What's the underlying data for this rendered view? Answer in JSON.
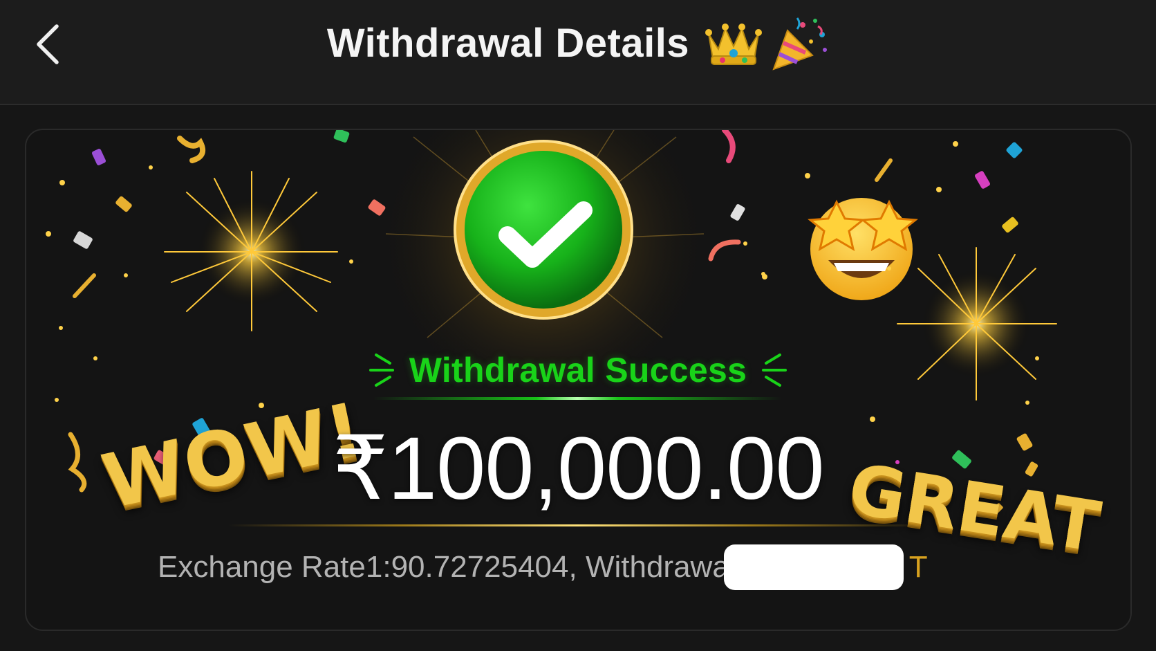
{
  "header": {
    "back_icon": "chevron-left-icon",
    "title": "Withdrawal Details",
    "title_icons": [
      "crown-icon",
      "party-popper-icon"
    ]
  },
  "card": {
    "status_icon": "green-checkmark-icon",
    "status_text": "Withdrawal Success",
    "amount": "₹100,000.00",
    "rate_text": "Exchange Rate1:90.72725404, Withdrawa",
    "rate_unit_suffix": "T",
    "decor_left_text": "WOW!",
    "decor_right_text": "GREAT",
    "decor_emoji": "star-struck-emoji-icon"
  },
  "colors": {
    "background": "#161616",
    "header_bg": "#1c1c1c",
    "success_green": "#19d319",
    "gold": "#f2c64a",
    "amount_white": "#ffffff",
    "rate_gray": "#b3b3b3"
  }
}
